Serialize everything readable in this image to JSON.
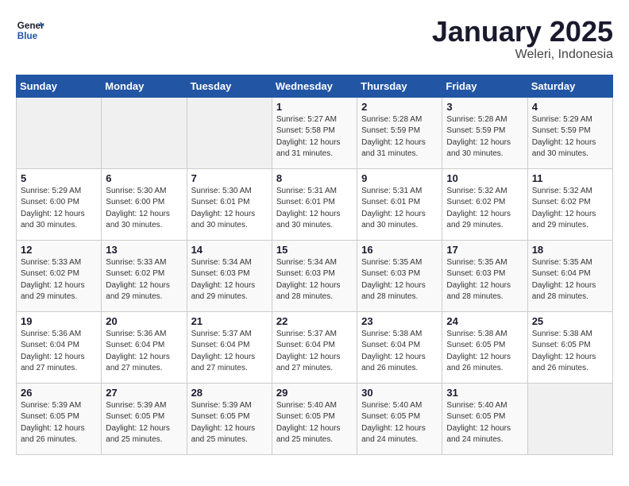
{
  "header": {
    "logo_line1": "General",
    "logo_line2": "Blue",
    "month": "January 2025",
    "location": "Weleri, Indonesia"
  },
  "weekdays": [
    "Sunday",
    "Monday",
    "Tuesday",
    "Wednesday",
    "Thursday",
    "Friday",
    "Saturday"
  ],
  "weeks": [
    [
      {
        "day": "",
        "empty": true
      },
      {
        "day": "",
        "empty": true
      },
      {
        "day": "",
        "empty": true
      },
      {
        "day": "1",
        "sunrise": "5:27 AM",
        "sunset": "5:58 PM",
        "daylight": "12 hours and 31 minutes."
      },
      {
        "day": "2",
        "sunrise": "5:28 AM",
        "sunset": "5:59 PM",
        "daylight": "12 hours and 31 minutes."
      },
      {
        "day": "3",
        "sunrise": "5:28 AM",
        "sunset": "5:59 PM",
        "daylight": "12 hours and 30 minutes."
      },
      {
        "day": "4",
        "sunrise": "5:29 AM",
        "sunset": "5:59 PM",
        "daylight": "12 hours and 30 minutes."
      }
    ],
    [
      {
        "day": "5",
        "sunrise": "5:29 AM",
        "sunset": "6:00 PM",
        "daylight": "12 hours and 30 minutes."
      },
      {
        "day": "6",
        "sunrise": "5:30 AM",
        "sunset": "6:00 PM",
        "daylight": "12 hours and 30 minutes."
      },
      {
        "day": "7",
        "sunrise": "5:30 AM",
        "sunset": "6:01 PM",
        "daylight": "12 hours and 30 minutes."
      },
      {
        "day": "8",
        "sunrise": "5:31 AM",
        "sunset": "6:01 PM",
        "daylight": "12 hours and 30 minutes."
      },
      {
        "day": "9",
        "sunrise": "5:31 AM",
        "sunset": "6:01 PM",
        "daylight": "12 hours and 30 minutes."
      },
      {
        "day": "10",
        "sunrise": "5:32 AM",
        "sunset": "6:02 PM",
        "daylight": "12 hours and 29 minutes."
      },
      {
        "day": "11",
        "sunrise": "5:32 AM",
        "sunset": "6:02 PM",
        "daylight": "12 hours and 29 minutes."
      }
    ],
    [
      {
        "day": "12",
        "sunrise": "5:33 AM",
        "sunset": "6:02 PM",
        "daylight": "12 hours and 29 minutes."
      },
      {
        "day": "13",
        "sunrise": "5:33 AM",
        "sunset": "6:02 PM",
        "daylight": "12 hours and 29 minutes."
      },
      {
        "day": "14",
        "sunrise": "5:34 AM",
        "sunset": "6:03 PM",
        "daylight": "12 hours and 29 minutes."
      },
      {
        "day": "15",
        "sunrise": "5:34 AM",
        "sunset": "6:03 PM",
        "daylight": "12 hours and 28 minutes."
      },
      {
        "day": "16",
        "sunrise": "5:35 AM",
        "sunset": "6:03 PM",
        "daylight": "12 hours and 28 minutes."
      },
      {
        "day": "17",
        "sunrise": "5:35 AM",
        "sunset": "6:03 PM",
        "daylight": "12 hours and 28 minutes."
      },
      {
        "day": "18",
        "sunrise": "5:35 AM",
        "sunset": "6:04 PM",
        "daylight": "12 hours and 28 minutes."
      }
    ],
    [
      {
        "day": "19",
        "sunrise": "5:36 AM",
        "sunset": "6:04 PM",
        "daylight": "12 hours and 27 minutes."
      },
      {
        "day": "20",
        "sunrise": "5:36 AM",
        "sunset": "6:04 PM",
        "daylight": "12 hours and 27 minutes."
      },
      {
        "day": "21",
        "sunrise": "5:37 AM",
        "sunset": "6:04 PM",
        "daylight": "12 hours and 27 minutes."
      },
      {
        "day": "22",
        "sunrise": "5:37 AM",
        "sunset": "6:04 PM",
        "daylight": "12 hours and 27 minutes."
      },
      {
        "day": "23",
        "sunrise": "5:38 AM",
        "sunset": "6:04 PM",
        "daylight": "12 hours and 26 minutes."
      },
      {
        "day": "24",
        "sunrise": "5:38 AM",
        "sunset": "6:05 PM",
        "daylight": "12 hours and 26 minutes."
      },
      {
        "day": "25",
        "sunrise": "5:38 AM",
        "sunset": "6:05 PM",
        "daylight": "12 hours and 26 minutes."
      }
    ],
    [
      {
        "day": "26",
        "sunrise": "5:39 AM",
        "sunset": "6:05 PM",
        "daylight": "12 hours and 26 minutes."
      },
      {
        "day": "27",
        "sunrise": "5:39 AM",
        "sunset": "6:05 PM",
        "daylight": "12 hours and 25 minutes."
      },
      {
        "day": "28",
        "sunrise": "5:39 AM",
        "sunset": "6:05 PM",
        "daylight": "12 hours and 25 minutes."
      },
      {
        "day": "29",
        "sunrise": "5:40 AM",
        "sunset": "6:05 PM",
        "daylight": "12 hours and 25 minutes."
      },
      {
        "day": "30",
        "sunrise": "5:40 AM",
        "sunset": "6:05 PM",
        "daylight": "12 hours and 24 minutes."
      },
      {
        "day": "31",
        "sunrise": "5:40 AM",
        "sunset": "6:05 PM",
        "daylight": "12 hours and 24 minutes."
      },
      {
        "day": "",
        "empty": true
      }
    ]
  ]
}
